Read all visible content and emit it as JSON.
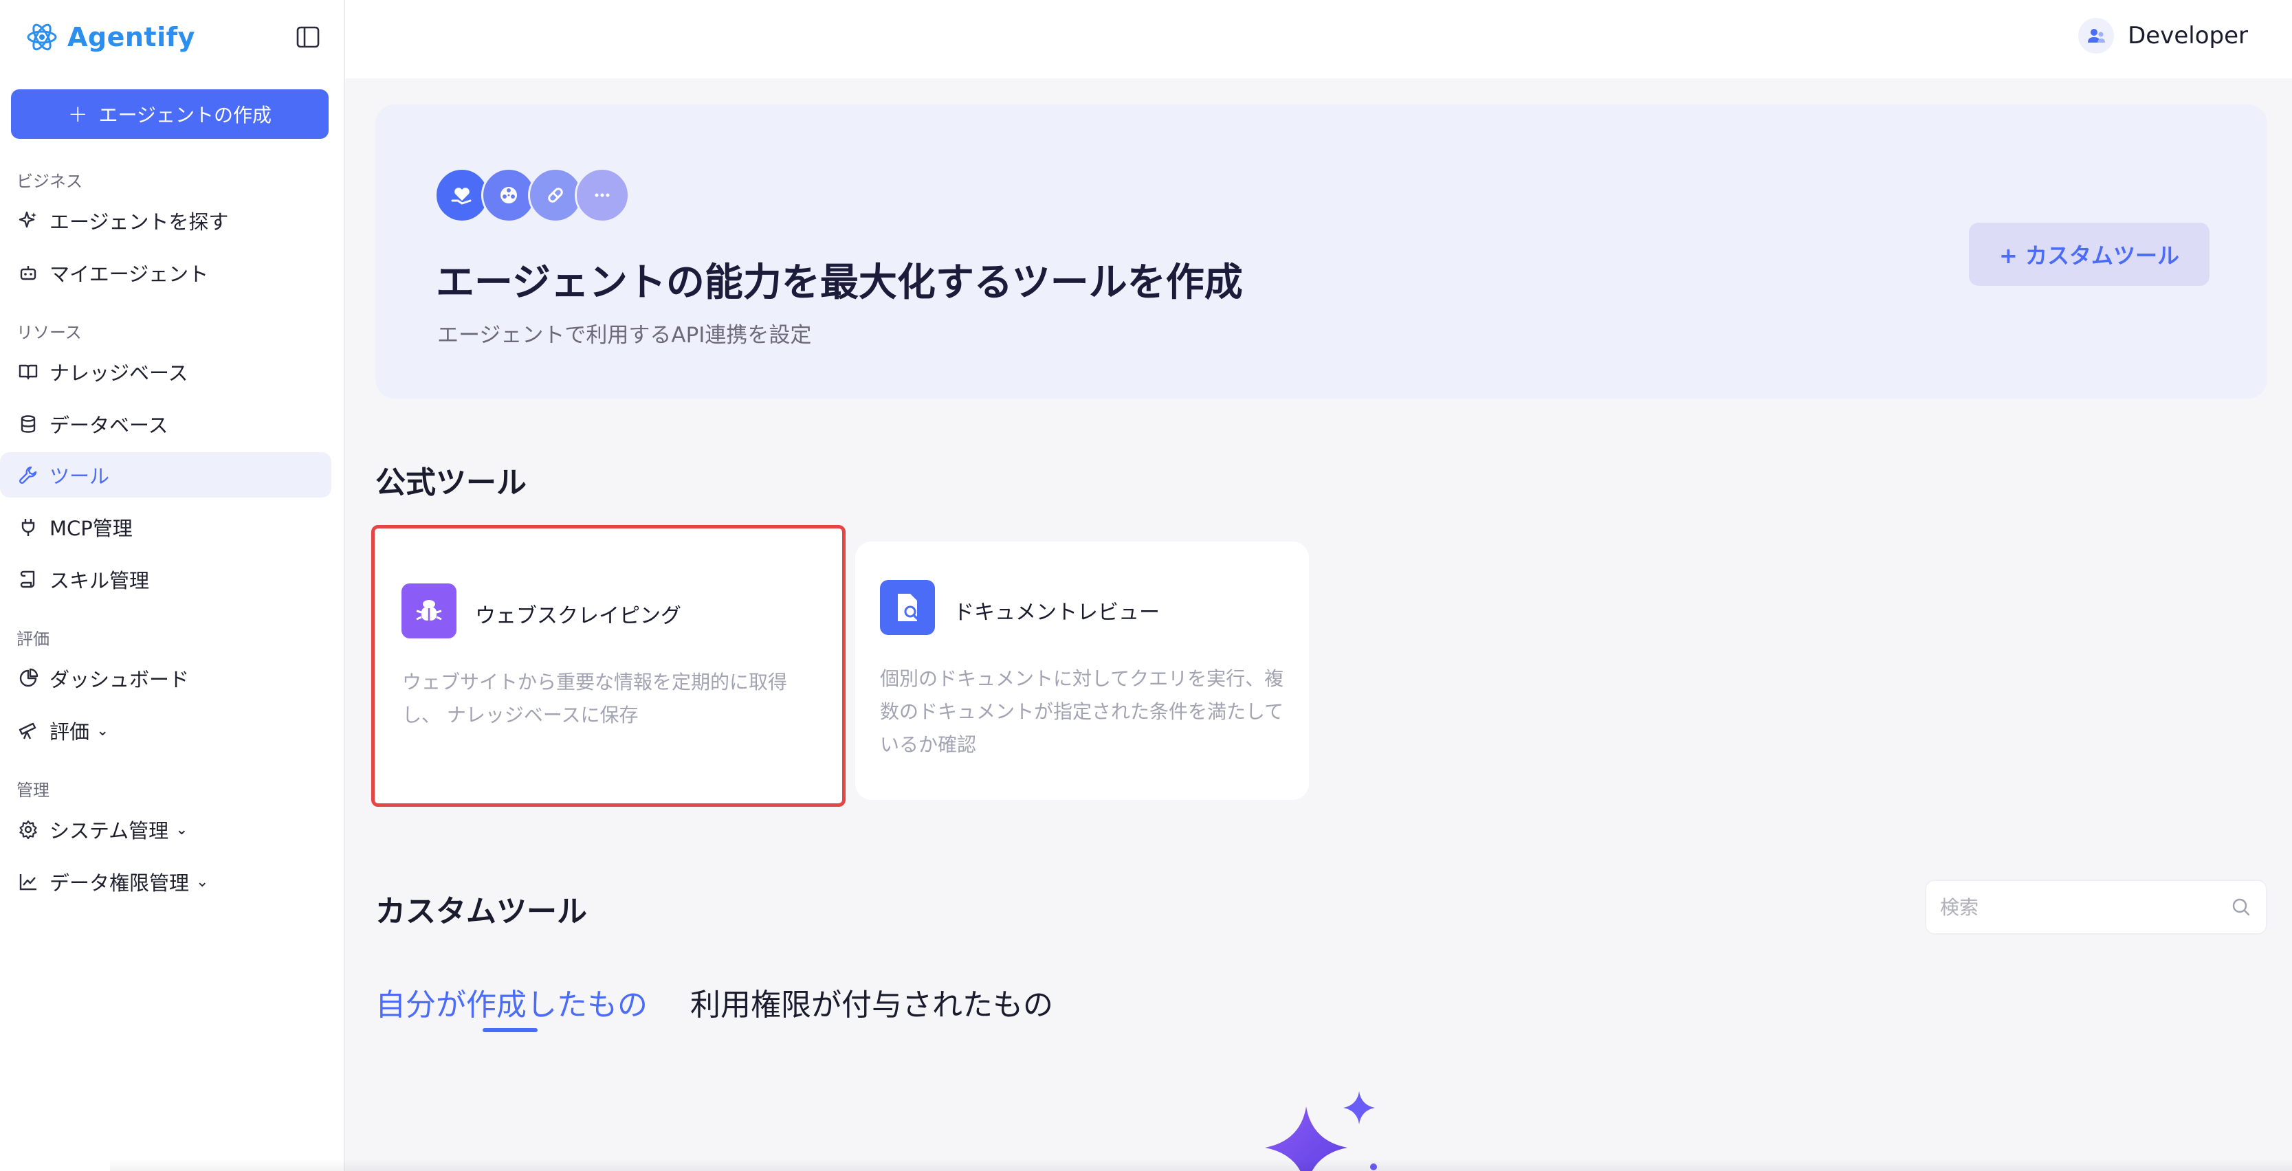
{
  "app": {
    "name": "Agentify"
  },
  "sidebar": {
    "create_label": "エージェントの作成",
    "sections": [
      {
        "label": "ビジネス"
      },
      {
        "label": "リソース"
      },
      {
        "label": "評価"
      },
      {
        "label": "管理"
      }
    ],
    "items": [
      {
        "label": "エージェントを探す",
        "icon": "sparkles-icon"
      },
      {
        "label": "マイエージェント",
        "icon": "robot-icon"
      },
      {
        "label": "ナレッジベース",
        "icon": "book-icon"
      },
      {
        "label": "データベース",
        "icon": "database-icon"
      },
      {
        "label": "ツール",
        "icon": "wrench-icon",
        "active": true
      },
      {
        "label": "MCP管理",
        "icon": "plug-icon"
      },
      {
        "label": "スキル管理",
        "icon": "scroll-icon"
      },
      {
        "label": "ダッシュボード",
        "icon": "pie-chart-icon"
      },
      {
        "label": "評価",
        "icon": "telescope-icon",
        "expandable": true
      },
      {
        "label": "システム管理",
        "icon": "gear-icon",
        "expandable": true
      },
      {
        "label": "データ権限管理",
        "icon": "line-chart-icon",
        "expandable": true
      }
    ]
  },
  "header": {
    "user_name": "Developer"
  },
  "hero": {
    "title": "エージェントの能力を最大化するツールを作成",
    "subtitle": "エージェントで利用するAPI連携を設定",
    "custom_tool_button": "+ カスタムツール",
    "icons": [
      "heart-hand-icon",
      "film-reel-icon",
      "pill-icon",
      "more-icon"
    ]
  },
  "official_tools": {
    "heading": "公式ツール",
    "cards": [
      {
        "name": "ウェブスクレイピング",
        "description": "ウェブサイトから重要な情報を定期的に取得し、 ナレッジベースに保存",
        "icon": "bug-icon",
        "color": "#8b5cf6"
      },
      {
        "name": "ドキュメントレビュー",
        "description": "個別のドキュメントに対してクエリを実行、複数のドキュメントが指定された条件を満たしているか確認",
        "icon": "doc-search-icon",
        "color": "#4b6cf7"
      }
    ]
  },
  "custom_tools": {
    "heading": "カスタムツール",
    "search_placeholder": "検索",
    "tabs": [
      {
        "label": "自分が作成したもの",
        "active": true
      },
      {
        "label": "利用権限が付与されたもの"
      }
    ]
  },
  "colors": {
    "accent": "#4b6cf7",
    "brand": "#2b8ff0",
    "selection": "#e64545",
    "hero_bg": "#eef0fb"
  }
}
